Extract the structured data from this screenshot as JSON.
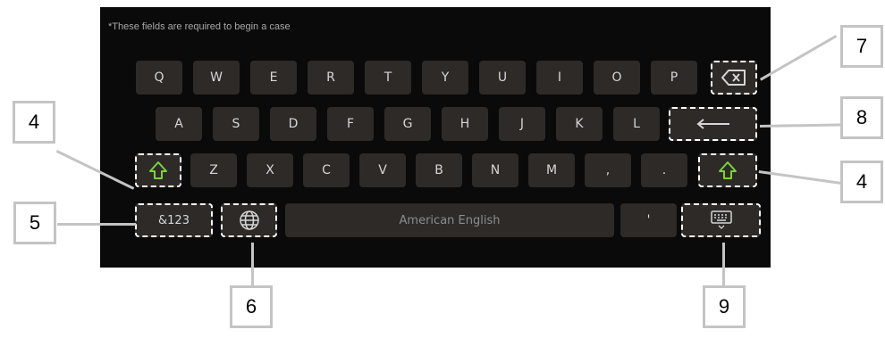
{
  "note": "*These fields are required to begin a case",
  "keyboard": {
    "row1": [
      "Q",
      "W",
      "E",
      "R",
      "T",
      "Y",
      "U",
      "I",
      "O",
      "P"
    ],
    "row2": [
      "A",
      "S",
      "D",
      "F",
      "G",
      "H",
      "J",
      "K",
      "L"
    ],
    "row3": [
      "Z",
      "X",
      "C",
      "V",
      "B",
      "N",
      "M",
      ",",
      "."
    ],
    "numbers_label": "&123",
    "space_label": "American English",
    "apostrophe_label": "'",
    "icons": {
      "backspace": "backspace-icon",
      "enter": "enter-icon",
      "shift": "shift-icon",
      "globe": "globe-icon",
      "hide": "keyboard-hide-icon"
    },
    "colors": {
      "panel": "#0a0a0a",
      "key": "#2d2a28",
      "key_text": "#d6d6d6",
      "shift_green": "#7bd23c"
    }
  },
  "callouts": {
    "shift_left": "4",
    "shift_right": "4",
    "numbers": "5",
    "globe": "6",
    "backspace": "7",
    "enter": "8",
    "hide": "9"
  }
}
